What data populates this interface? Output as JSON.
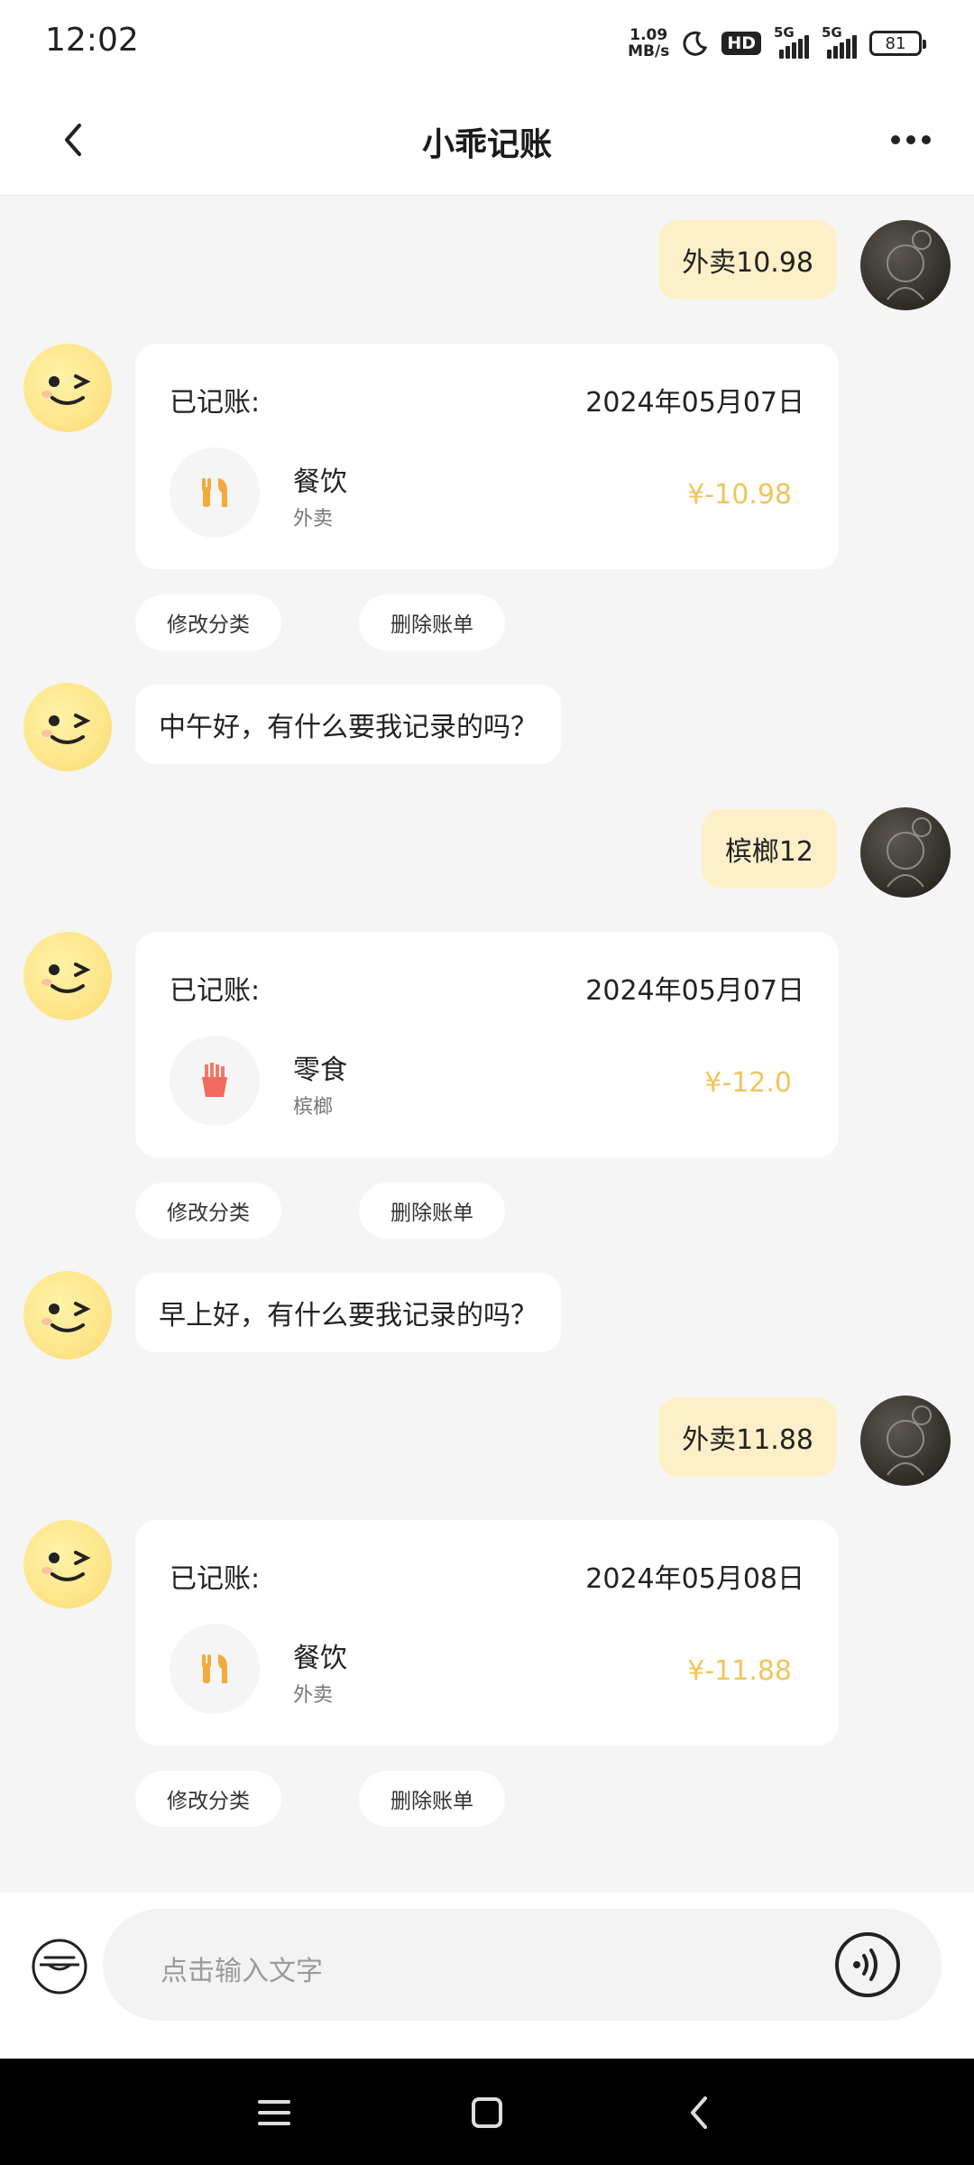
{
  "status_bar": {
    "time": "12:02",
    "net_speed_value": "1.09",
    "net_speed_unit": "MB/s",
    "hd_badge": "HD",
    "signal_1": "5G",
    "signal_2": "5G",
    "battery": "81"
  },
  "header": {
    "title": "小乖记账"
  },
  "messages": [
    {
      "type": "user",
      "text": "外卖10.98"
    },
    {
      "type": "record",
      "label": "已记账:",
      "date": "2024年05月07日",
      "category": "餐饮",
      "note": "外卖",
      "amount": "¥-10.98",
      "icon": "fork-knife-icon"
    },
    {
      "type": "bot",
      "text": "中午好，有什么要我记录的吗？"
    },
    {
      "type": "user",
      "text": "槟榔12"
    },
    {
      "type": "record",
      "label": "已记账:",
      "date": "2024年05月07日",
      "category": "零食",
      "note": "槟榔",
      "amount": "¥-12.0",
      "icon": "fries-icon"
    },
    {
      "type": "bot",
      "text": "早上好，有什么要我记录的吗？"
    },
    {
      "type": "user",
      "text": "外卖11.88"
    },
    {
      "type": "record",
      "label": "已记账:",
      "date": "2024年05月08日",
      "category": "餐饮",
      "note": "外卖",
      "amount": "¥-11.88",
      "icon": "fork-knife-icon"
    }
  ],
  "actions": {
    "edit_category": "修改分类",
    "delete_bill": "删除账单"
  },
  "input": {
    "placeholder": "点击输入文字"
  },
  "colors": {
    "user_bubble": "#fdf0c9",
    "amount": "#f2c45a",
    "background": "#f5f5f5"
  }
}
